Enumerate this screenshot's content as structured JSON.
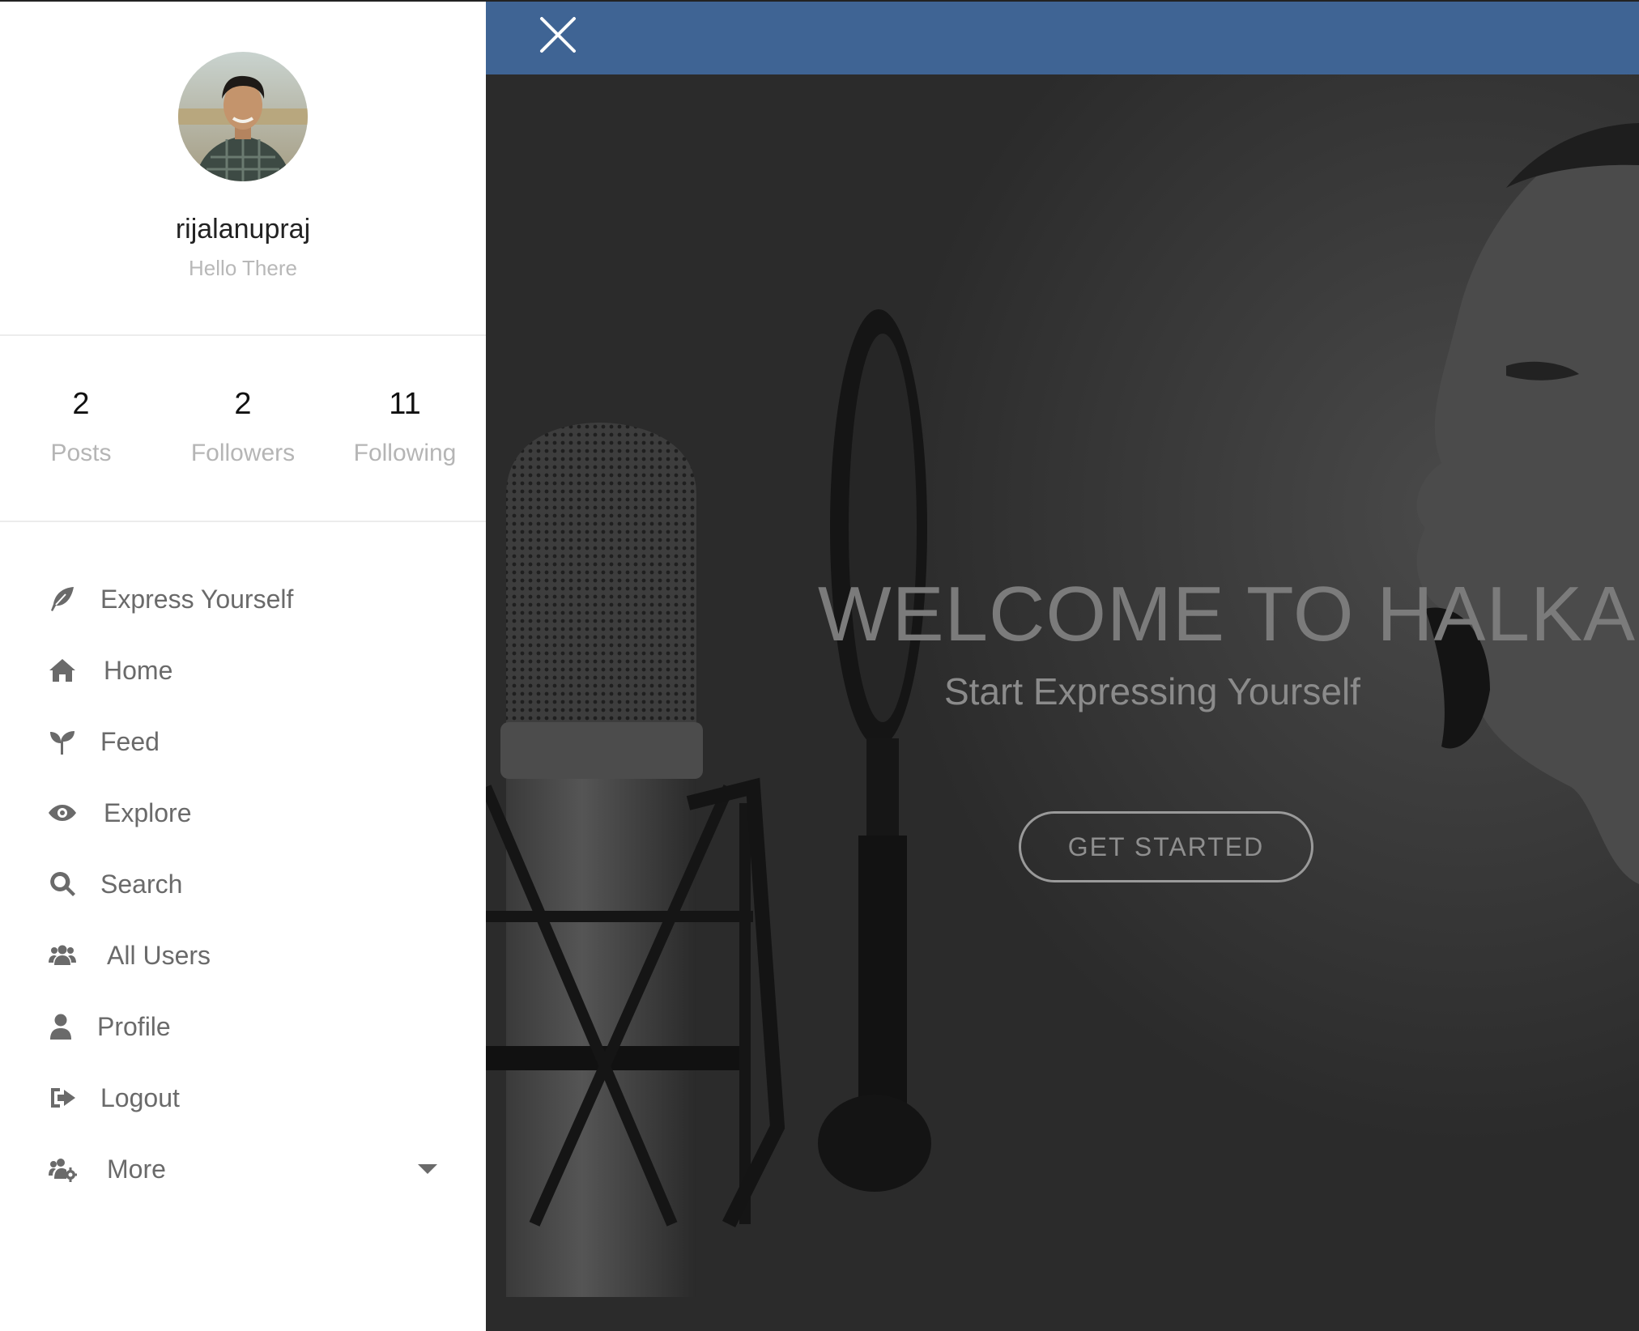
{
  "profile": {
    "username": "rijalanupraj",
    "bio": "Hello There"
  },
  "stats": [
    {
      "value": "2",
      "label": "Posts"
    },
    {
      "value": "2",
      "label": "Followers"
    },
    {
      "value": "11",
      "label": "Following"
    }
  ],
  "menu": [
    {
      "label": "Express Yourself",
      "icon": "feather-icon"
    },
    {
      "label": "Home",
      "icon": "home-icon"
    },
    {
      "label": "Feed",
      "icon": "seedling-icon"
    },
    {
      "label": "Explore",
      "icon": "eye-icon"
    },
    {
      "label": "Search",
      "icon": "search-icon"
    },
    {
      "label": "All Users",
      "icon": "users-icon"
    },
    {
      "label": "Profile",
      "icon": "user-icon"
    },
    {
      "label": "Logout",
      "icon": "logout-icon"
    },
    {
      "label": "More",
      "icon": "users-cog-icon"
    }
  ],
  "topbar": {
    "close_icon": "close-icon",
    "color": "#3f6494"
  },
  "hero": {
    "title": "WELCOME TO HALKAPAN",
    "subtitle": "Start Expressing Yourself",
    "cta_label": "GET STARTED"
  }
}
